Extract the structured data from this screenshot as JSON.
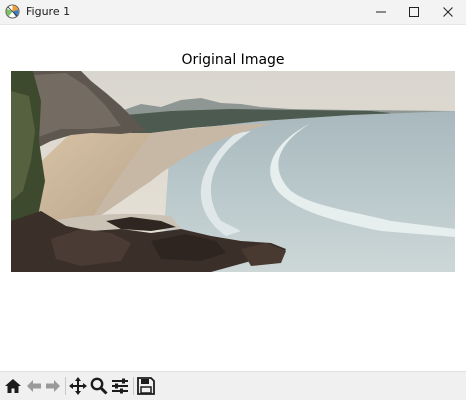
{
  "window": {
    "title": "Figure 1"
  },
  "figure": {
    "title": "Original Image"
  },
  "toolbar": {
    "buttons": [
      "home-icon",
      "back-arrow-icon",
      "forward-arrow-icon",
      "pan-icon",
      "zoom-icon",
      "configure-subplots-icon",
      "save-icon"
    ]
  }
}
